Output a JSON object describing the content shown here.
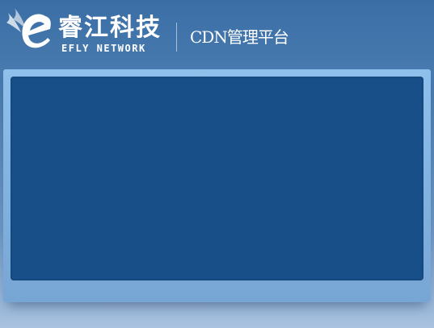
{
  "brand": {
    "name_cn": "睿江科技",
    "name_en": "EFLY NETWORK",
    "logo_icon": "efly-winged-e-logo",
    "accent_color": "#184f88",
    "frame_color": "#8fc0ec"
  },
  "header": {
    "title": "CDN管理平台"
  }
}
